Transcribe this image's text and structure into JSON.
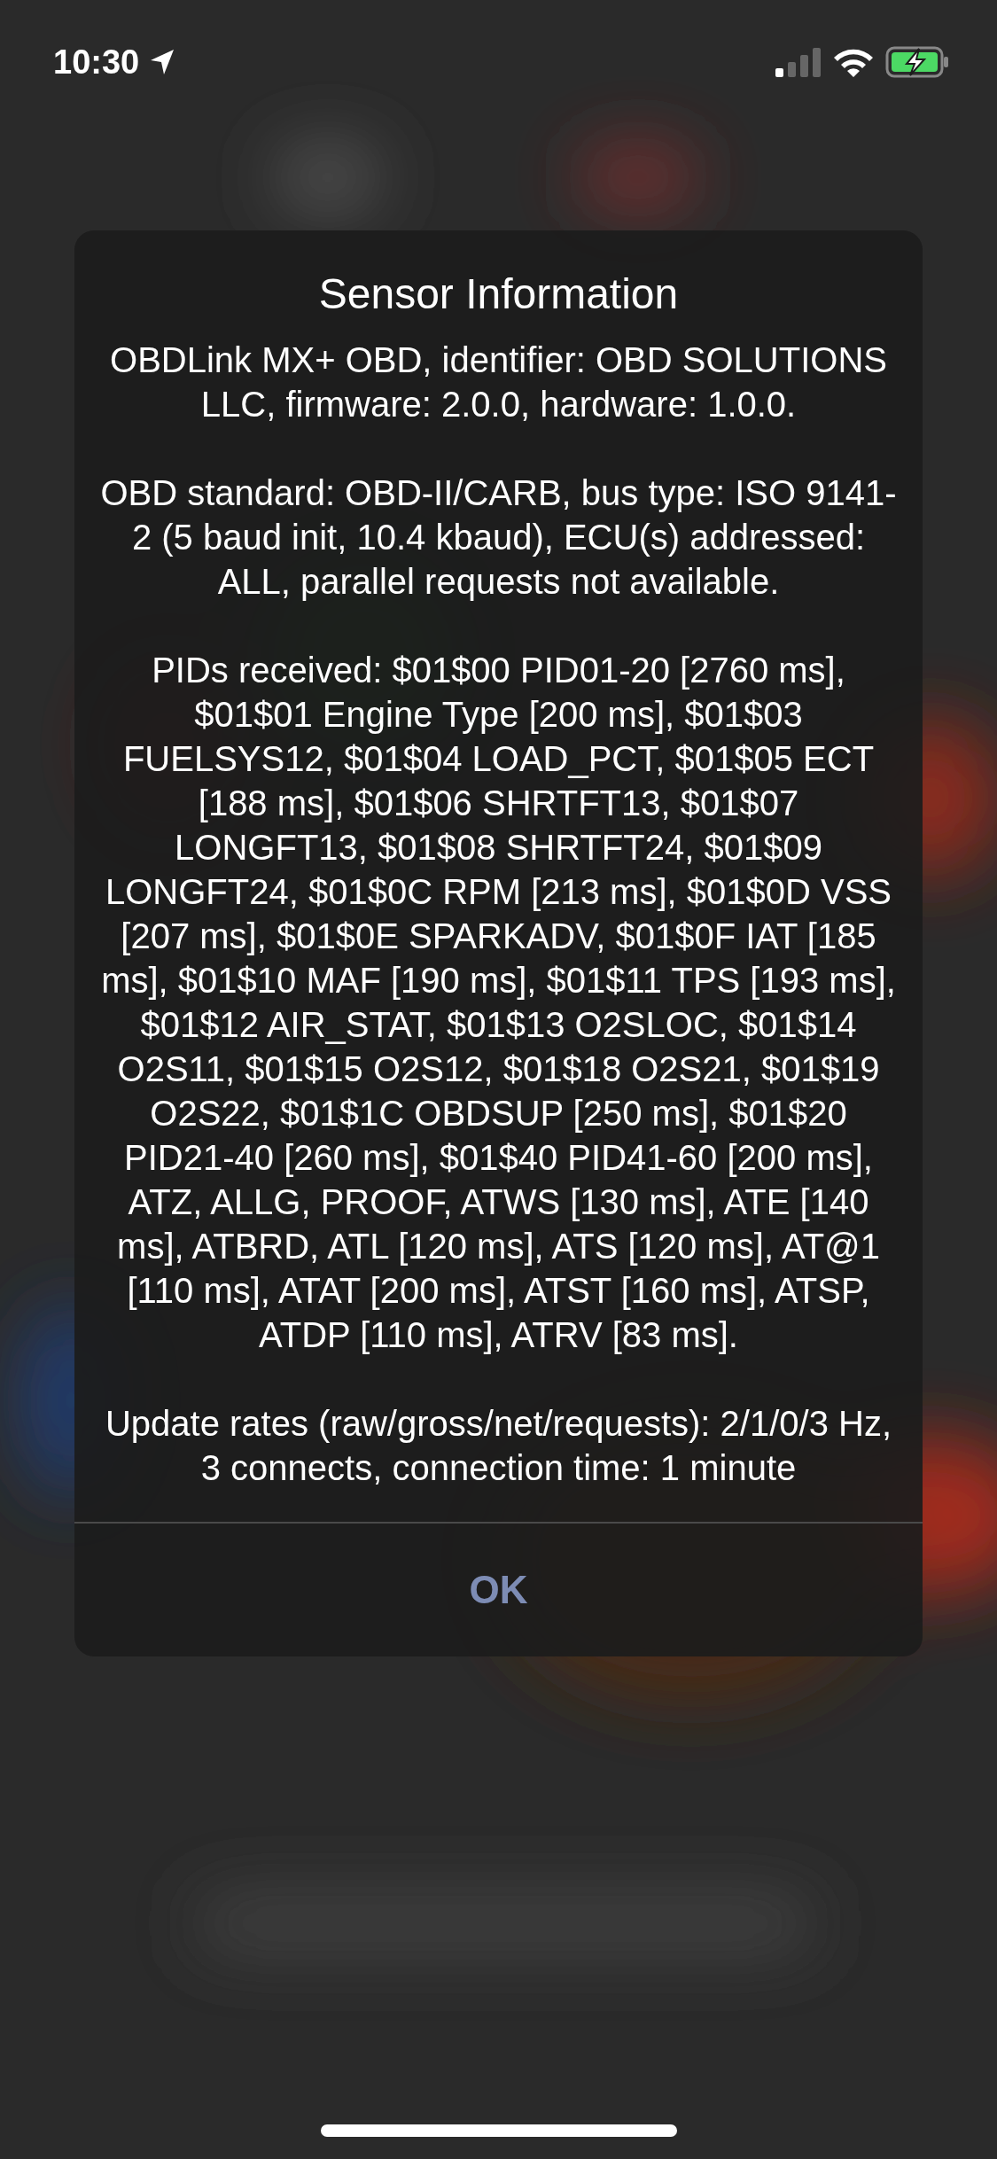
{
  "status_bar": {
    "time": "10:30"
  },
  "alert": {
    "title": "Sensor Information",
    "paragraphs": [
      "OBDLink MX+ OBD, identifier: OBD SOLUTIONS LLC, firmware: 2.0.0, hardware: 1.0.0.",
      "OBD standard: OBD-II/CARB, bus type: ISO 9141-2 (5 baud init, 10.4 kbaud), ECU(s) addressed: ALL, parallel requests not available.",
      "PIDs received: $01$00 PID01-20 [2760 ms], $01$01 Engine Type [200 ms], $01$03 FUELSYS12, $01$04 LOAD_PCT, $01$05 ECT [188 ms], $01$06 SHRTFT13, $01$07 LONGFT13, $01$08 SHRTFT24, $01$09 LONGFT24, $01$0C RPM [213 ms], $01$0D VSS [207 ms], $01$0E SPARKADV, $01$0F IAT [185 ms], $01$10 MAF [190 ms], $01$11 TPS [193 ms], $01$12 AIR_STAT, $01$13 O2SLOC, $01$14 O2S11, $01$15 O2S12, $01$18 O2S21, $01$19 O2S22, $01$1C OBDSUP [250 ms], $01$20 PID21-40 [260 ms], $01$40 PID41-60 [200 ms], ATZ, ALLG, PROOF, ATWS [130 ms], ATE [140 ms], ATBRD, ATL [120 ms], ATS [120 ms], AT@1 [110 ms], ATAT [200 ms], ATST [160 ms], ATSP, ATDP [110 ms], ATRV [83 ms].",
      "Update rates (raw/gross/net/requests): 2/1/0/3 Hz, 3 connects, connection time: 1 minute"
    ],
    "buttons": [
      "OK"
    ]
  }
}
